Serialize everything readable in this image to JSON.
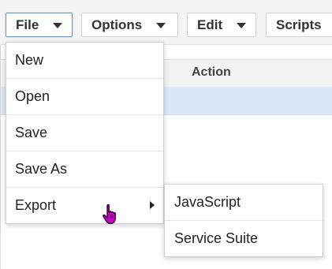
{
  "toolbar": {
    "menus": [
      {
        "label": "File"
      },
      {
        "label": "Options"
      },
      {
        "label": "Edit"
      },
      {
        "label": "Scripts"
      }
    ]
  },
  "table": {
    "columns": [
      {
        "label": "Action"
      }
    ]
  },
  "file_menu": {
    "items": [
      {
        "label": "New"
      },
      {
        "label": "Open"
      },
      {
        "label": "Save"
      },
      {
        "label": "Save As"
      },
      {
        "label": "Export"
      }
    ]
  },
  "export_submenu": {
    "items": [
      {
        "label": "JavaScript"
      },
      {
        "label": "Service Suite"
      }
    ]
  },
  "cursor": {
    "icon": "hand-pointer-icon",
    "color": "#cc00cc"
  }
}
